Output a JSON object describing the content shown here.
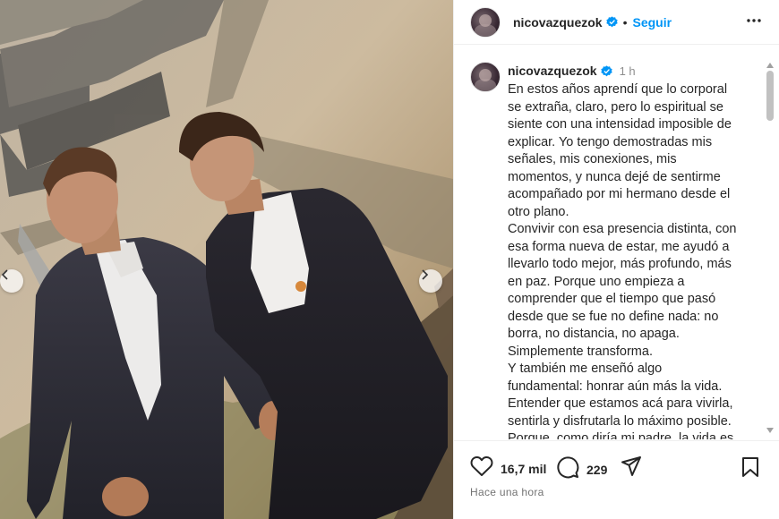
{
  "post": {
    "username": "nicovazquezok",
    "follow_label": "Seguir",
    "time_short": "1 h",
    "time_long": "Hace una hora",
    "caption": "En estos años aprendí que lo corporal\nse extraña, claro, pero lo espiritual se\nsiente con una intensidad imposible de\nexplicar. Yo tengo demostradas mis\nseñales, mis conexiones, mis\nmomentos, y nunca dejé de sentirme\nacompañado por mi hermano desde el\notro plano.\nConvivir con esa presencia distinta, con\nesa forma nueva de estar, me ayudó a\nllevarlo todo mejor, más profundo, más\nen paz. Porque uno empieza a\ncomprender que el tiempo que pasó\ndesde que se fue no define nada: no\nborra, no distancia, no apaga.\nSimplemente transforma.\nY también me enseñó algo\nfundamental: honrar aún más la vida.\nEntender que estamos acá para vivirla,\nsentirla y disfrutarla lo máximo posible.\nPorque, como diría mi padre, la vida es",
    "likes": "16,7 mil",
    "comments": "229"
  },
  "icons": {
    "verified": "verified-badge-icon",
    "more": "more-options-icon",
    "like": "heart-icon",
    "comment": "comment-icon",
    "share": "share-icon",
    "save": "bookmark-icon",
    "prev": "chevron-left-icon",
    "next": "chevron-right-icon"
  },
  "colors": {
    "accent": "#0095f6",
    "verified": "#0095f6"
  }
}
